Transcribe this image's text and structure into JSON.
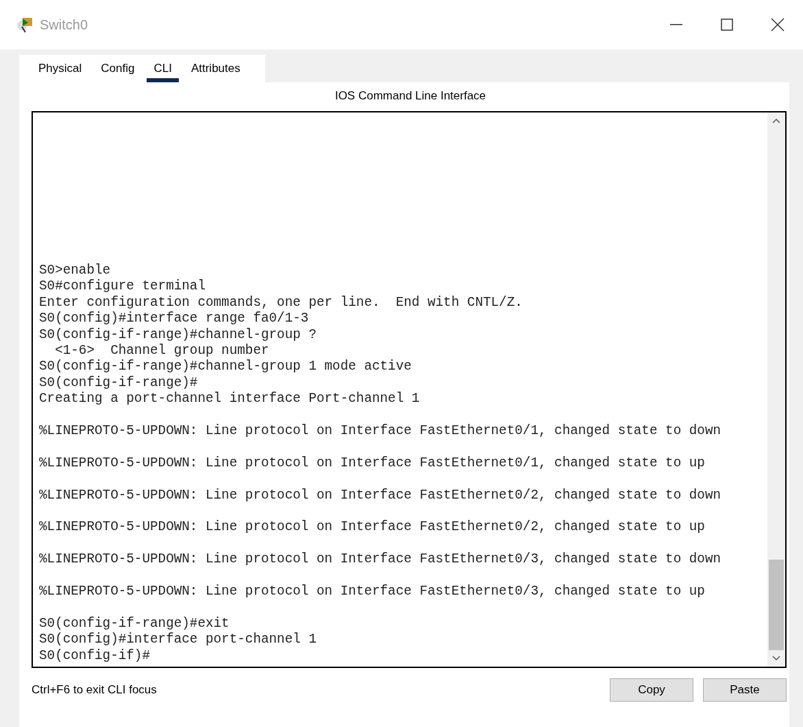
{
  "window": {
    "title": "Switch0"
  },
  "tabs": [
    {
      "label": "Physical",
      "selected": false
    },
    {
      "label": "Config",
      "selected": false
    },
    {
      "label": "CLI",
      "selected": true
    },
    {
      "label": "Attributes",
      "selected": false
    }
  ],
  "panel_title": "IOS Command Line Interface",
  "terminal": {
    "lines": [
      {
        "text": "S0>enable",
        "spaced": false
      },
      {
        "text": "S0#configure terminal",
        "spaced": false
      },
      {
        "text": "Enter configuration commands, one per line.  End with CNTL/Z.",
        "spaced": false
      },
      {
        "text": "S0(config)#interface range fa0/1-3",
        "spaced": false
      },
      {
        "text": "S0(config-if-range)#channel-group ?",
        "spaced": false
      },
      {
        "text": "  <1-6>  Channel group number",
        "spaced": false
      },
      {
        "text": "S0(config-if-range)#channel-group 1 mode active",
        "spaced": false
      },
      {
        "text": "S0(config-if-range)#",
        "spaced": false
      },
      {
        "text": "Creating a port-channel interface Port-channel 1",
        "spaced": false
      },
      {
        "text": "%LINEPROTO-5-UPDOWN: Line protocol on Interface FastEthernet0/1, changed state to down",
        "spaced": true
      },
      {
        "text": "%LINEPROTO-5-UPDOWN: Line protocol on Interface FastEthernet0/1, changed state to up",
        "spaced": true
      },
      {
        "text": "%LINEPROTO-5-UPDOWN: Line protocol on Interface FastEthernet0/2, changed state to down",
        "spaced": true
      },
      {
        "text": "%LINEPROTO-5-UPDOWN: Line protocol on Interface FastEthernet0/2, changed state to up",
        "spaced": true
      },
      {
        "text": "%LINEPROTO-5-UPDOWN: Line protocol on Interface FastEthernet0/3, changed state to down",
        "spaced": true
      },
      {
        "text": "%LINEPROTO-5-UPDOWN: Line protocol on Interface FastEthernet0/3, changed state to up",
        "spaced": true
      },
      {
        "text": "S0(config-if-range)#exit",
        "spaced": true
      },
      {
        "text": "S0(config)#interface port-channel 1",
        "spaced": false
      },
      {
        "text": "S0(config-if)#",
        "spaced": false
      }
    ]
  },
  "footer": {
    "hint": "Ctrl+F6 to exit CLI focus",
    "buttons": [
      "Copy",
      "Paste"
    ]
  }
}
